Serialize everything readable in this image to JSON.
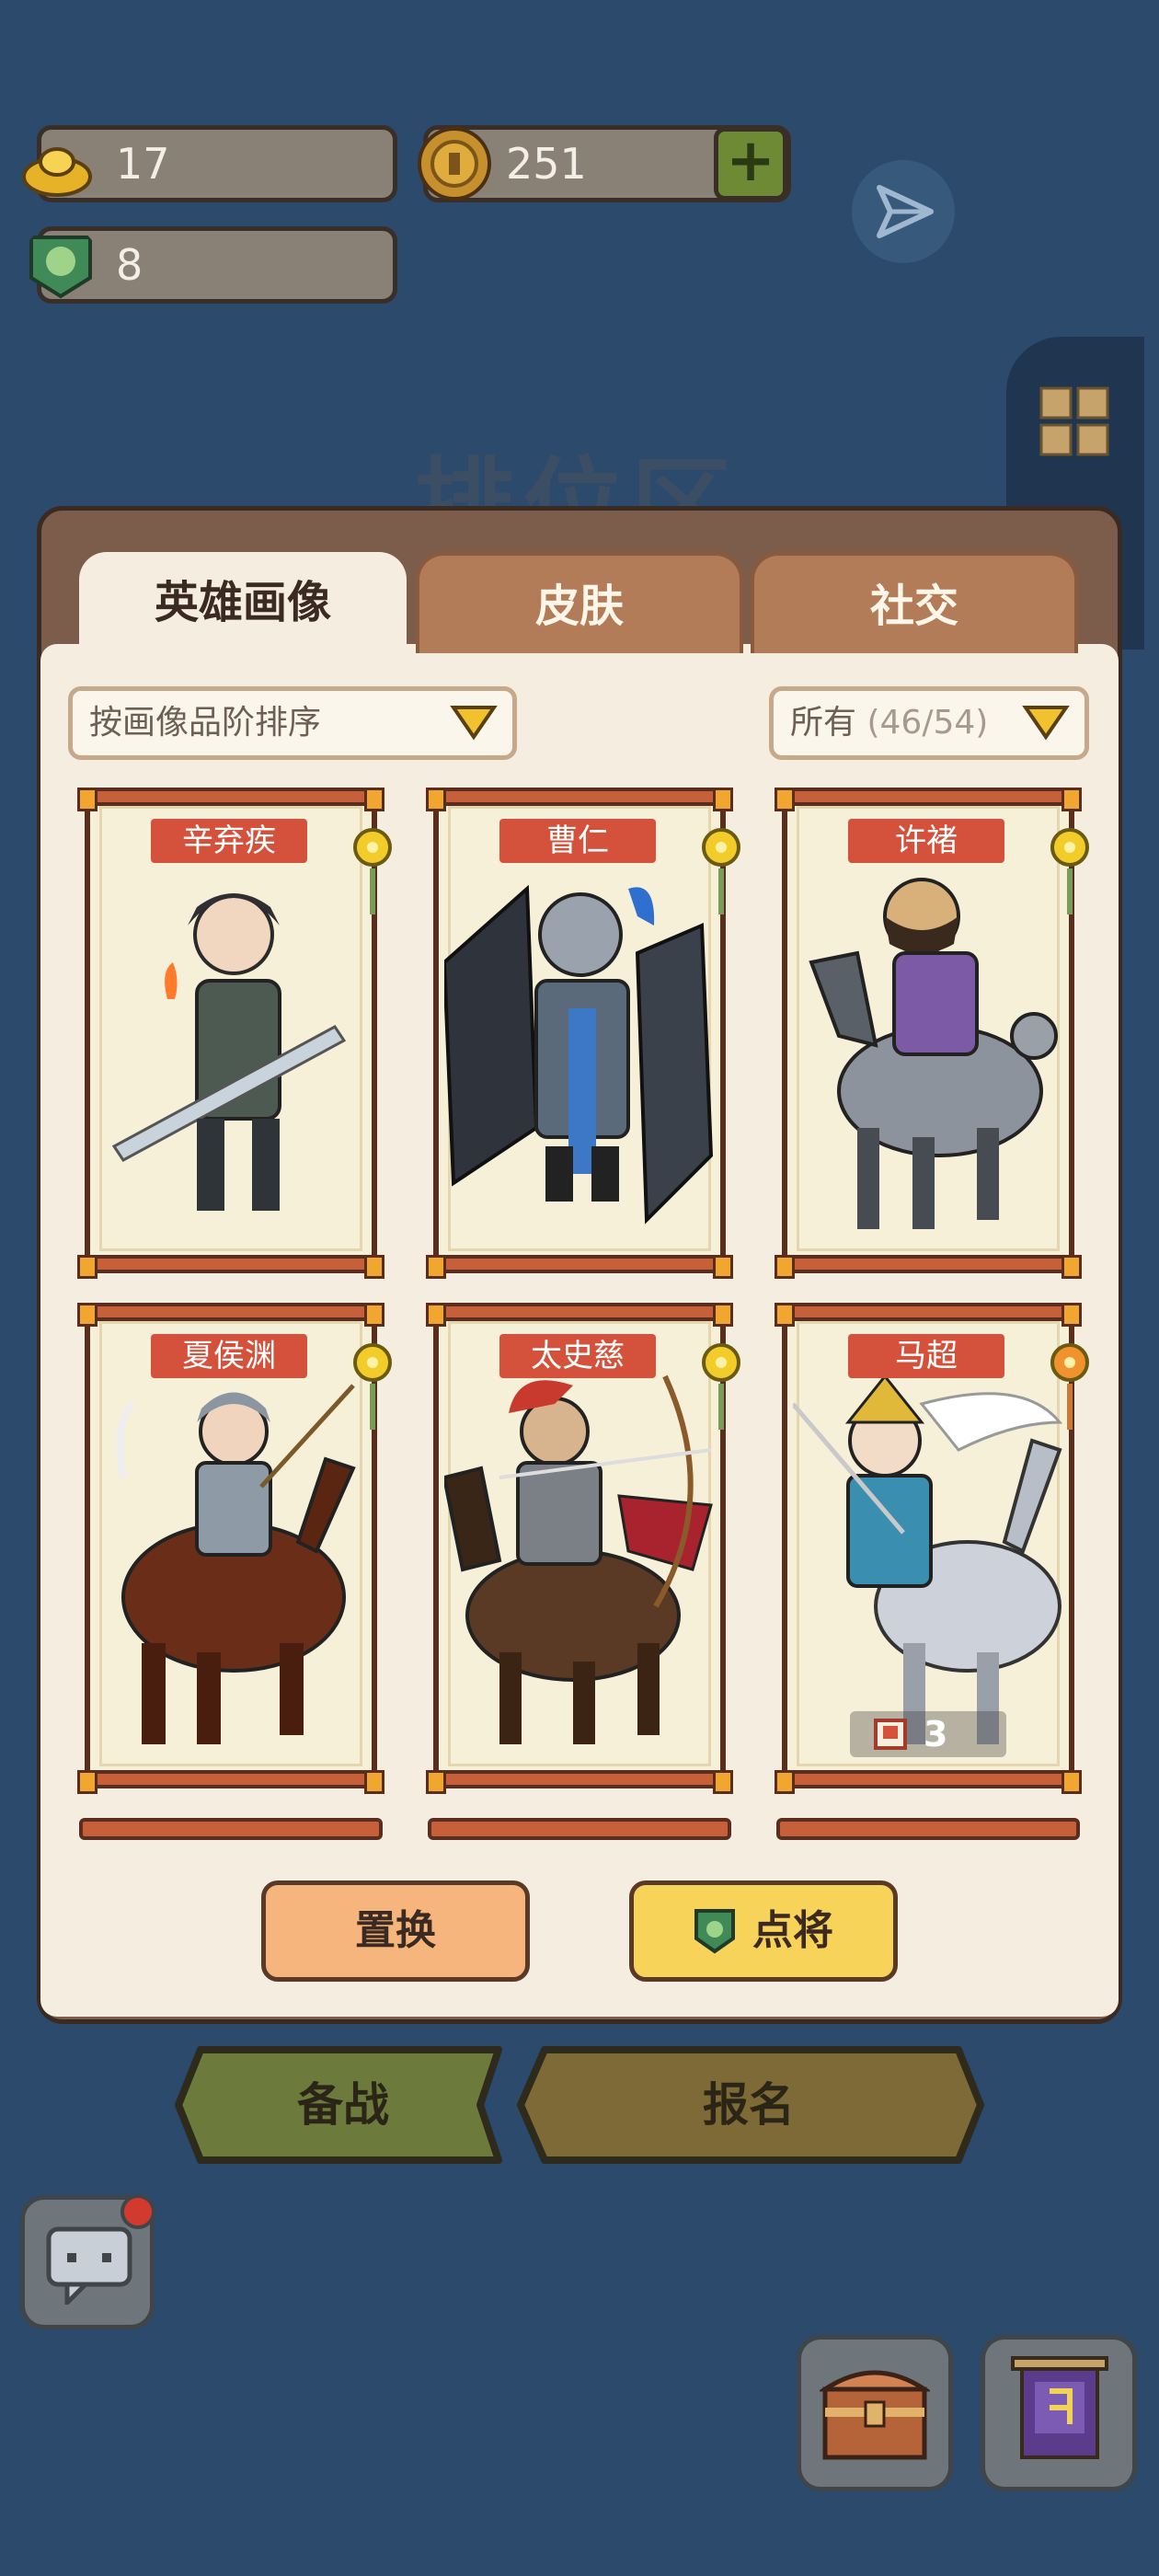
{
  "resources": {
    "gold_ingot": "17",
    "coin": "251",
    "jade": "8"
  },
  "background_title": "排位区",
  "tabs": [
    {
      "label": "英雄画像",
      "active": true
    },
    {
      "label": "皮肤",
      "active": false
    },
    {
      "label": "社交",
      "active": false
    }
  ],
  "filters": {
    "sort": "按画像品阶排序",
    "scope": "所有",
    "scope_count": "(46/54)"
  },
  "heroes": [
    {
      "name": "辛弃疾",
      "gem": "yellow"
    },
    {
      "name": "曹仁",
      "gem": "yellow"
    },
    {
      "name": "许褚",
      "gem": "yellow"
    },
    {
      "name": "夏侯渊",
      "gem": "yellow"
    },
    {
      "name": "太史慈",
      "gem": "yellow"
    },
    {
      "name": "马超",
      "gem": "orange",
      "badge": "3"
    }
  ],
  "actions": {
    "replace": "置换",
    "pick": "点将"
  },
  "bottom": {
    "prepare": "备战",
    "signup": "报名"
  },
  "colors": {
    "background": "#2b4a6c",
    "panel": "#f5ede0",
    "tab_inactive": "#b37c58",
    "name_tag": "#d4523c",
    "replace_btn": "#f6b57c",
    "pick_btn": "#f7d35a",
    "prepare_btn": "#6c7a3c",
    "signup_btn": "#7d6a36"
  }
}
